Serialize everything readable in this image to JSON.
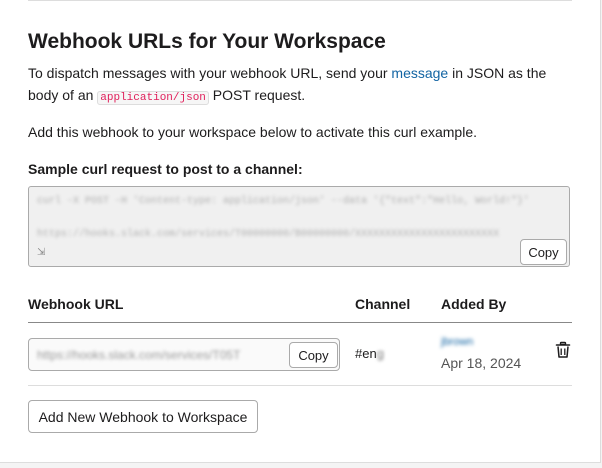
{
  "header": {
    "title": "Webhook URLs for Your Workspace"
  },
  "intro": {
    "before_link": "To dispatch messages with your webhook URL, send your ",
    "link_text": "message",
    "after_link": " in JSON as the body of an ",
    "code": "application/json",
    "after_code": " POST request."
  },
  "instruction": "Add this webhook to your workspace below to activate this curl example.",
  "curl": {
    "label": "Sample curl request to post to a channel:",
    "lines": [
      "curl -X POST -H 'Content-type: application/json' --data '{\"text\":\"Hello, World!\"}'",
      "https://hooks.slack.com/services/T00000000/B00000000/XXXXXXXXXXXXXXXXXXXXXXXX"
    ],
    "copy_label": "Copy"
  },
  "table": {
    "columns": [
      "Webhook URL",
      "Channel",
      "Added By"
    ],
    "rows": [
      {
        "url": "https://hooks.slack.com/services/T05T",
        "copy_label": "Copy",
        "channel_visible": "#en",
        "channel_hidden": "g",
        "added_by": "jbrown",
        "added_date": "Apr 18, 2024"
      }
    ]
  },
  "actions": {
    "add_label": "Add New Webhook to Workspace"
  },
  "colors": {
    "link": "#1264a3",
    "code": "#e01e5a",
    "text": "#1d1c1d",
    "muted": "#555555"
  },
  "icons": {
    "delete": "trash-icon",
    "resize": "resize-handle-icon"
  }
}
